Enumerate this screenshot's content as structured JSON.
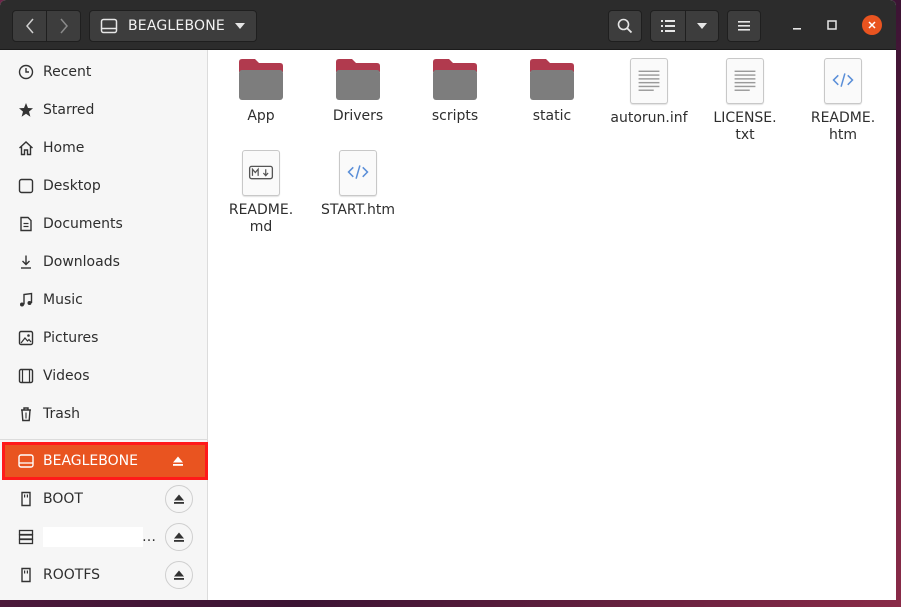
{
  "header": {
    "location": "BEAGLEBONE"
  },
  "sidebar": {
    "places": [
      {
        "label": "Recent",
        "icon": "clock-icon"
      },
      {
        "label": "Starred",
        "icon": "star-icon"
      },
      {
        "label": "Home",
        "icon": "home-icon"
      },
      {
        "label": "Desktop",
        "icon": "desktop-icon"
      },
      {
        "label": "Documents",
        "icon": "documents-icon"
      },
      {
        "label": "Downloads",
        "icon": "download-icon"
      },
      {
        "label": "Music",
        "icon": "music-icon"
      },
      {
        "label": "Pictures",
        "icon": "pictures-icon"
      },
      {
        "label": "Videos",
        "icon": "videos-icon"
      },
      {
        "label": "Trash",
        "icon": "trash-icon"
      }
    ],
    "devices": [
      {
        "label": "BEAGLEBONE",
        "icon": "drive-icon",
        "active": true
      },
      {
        "label": "BOOT",
        "icon": "removable-drive-icon"
      },
      {
        "label": "…",
        "icon": "network-drive-icon"
      },
      {
        "label": "ROOTFS",
        "icon": "removable-drive-icon"
      }
    ]
  },
  "files": [
    {
      "name": "App",
      "kind": "folder"
    },
    {
      "name": "Drivers",
      "kind": "folder"
    },
    {
      "name": "scripts",
      "kind": "folder"
    },
    {
      "name": "static",
      "kind": "folder"
    },
    {
      "name": "autorun.inf",
      "kind": "text"
    },
    {
      "name": "LICENSE.\ntxt",
      "kind": "text"
    },
    {
      "name": "README.\nhtm",
      "kind": "html"
    },
    {
      "name": "README.\nmd",
      "kind": "markdown"
    },
    {
      "name": "START.htm",
      "kind": "html"
    }
  ],
  "colors": {
    "accent": "#e95420",
    "highlight_outline": "#ff1a1a",
    "folder_top": "#b13a4e",
    "folder_body": "#7d7d7d",
    "html_icon": "#5b8fd8"
  }
}
